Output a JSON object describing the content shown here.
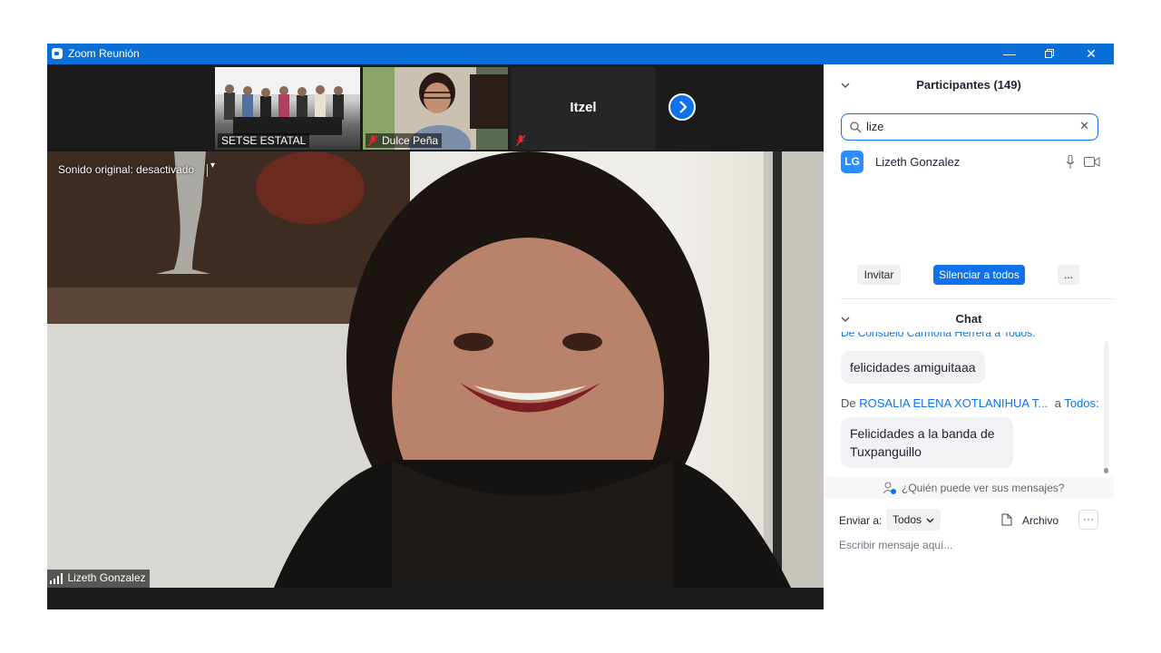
{
  "window": {
    "title": "Zoom Reunión"
  },
  "gallery": {
    "tiles": [
      {
        "name": "SETSE ESTATAL",
        "muted": false
      },
      {
        "name": "Dulce Peña",
        "muted": true
      },
      {
        "name": "Itzel",
        "muted": true
      }
    ]
  },
  "main_video": {
    "audio_status": "Sonido original: desactivado",
    "speaker_name": "Lizeth Gonzalez"
  },
  "participants": {
    "header": "Participantes (149)",
    "search_value": "lize",
    "results": [
      {
        "initials": "LG",
        "name": "Lizeth Gonzalez",
        "avatar_color": "#2d8cff"
      }
    ],
    "invite_label": "Invitar",
    "mute_all_label": "Silenciar a todos",
    "more_label": "..."
  },
  "chat": {
    "header": "Chat",
    "partial_sender_line": "De Consuelo Carmona Herrera a Todos:",
    "messages": [
      {
        "text": "felicidades amiguitaaa"
      },
      {
        "from_prefix": "De",
        "sender": "ROSALIA ELENA XOTLANIHUA T...",
        "to_prefix": "a",
        "recipient": "Todos:",
        "text": "Felicidades a la banda de Tuxpanguillo"
      }
    ],
    "who_can_see": "¿Quién puede ver sus mensajes?",
    "send_to_label": "Enviar a:",
    "send_to_value": "Todos",
    "file_label": "Archivo",
    "input_placeholder": "Escribir mensaje aquí..."
  },
  "colors": {
    "accent": "#0e72ed",
    "titlebar": "#0b6fd8",
    "link": "#0e72ed"
  }
}
